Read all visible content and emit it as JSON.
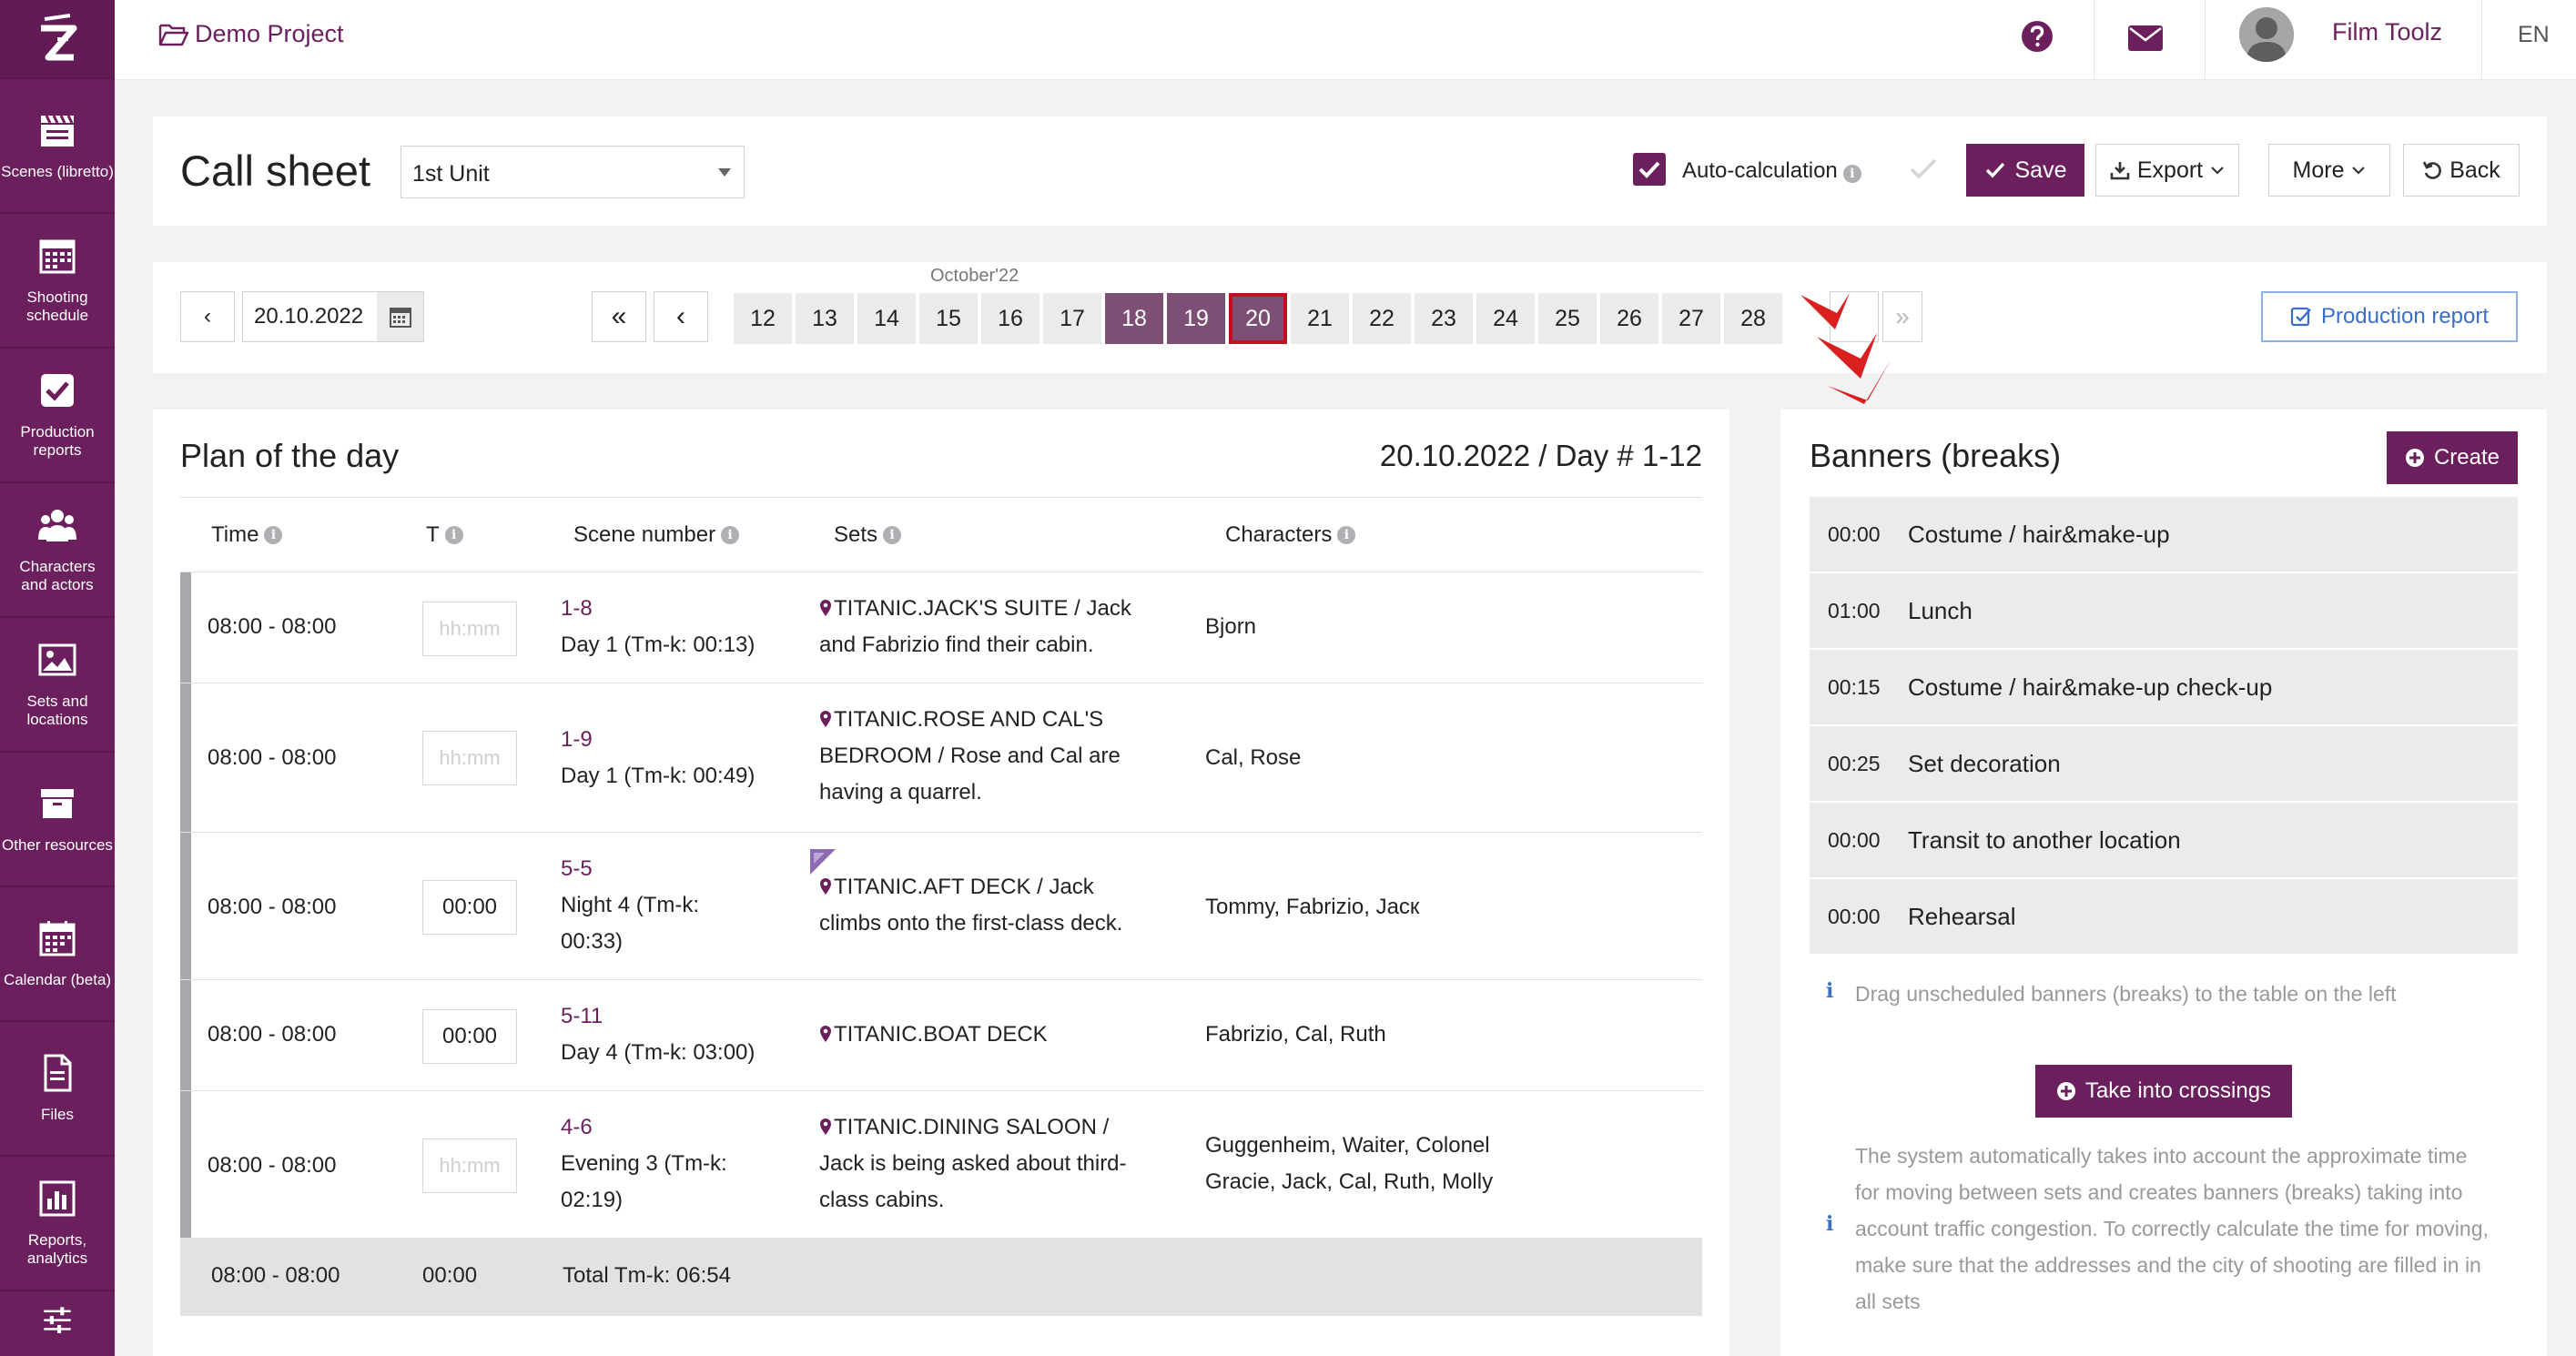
{
  "sidebar": {
    "items": [
      {
        "label": "Scenes (libretto)",
        "icon": "clapperboard-icon"
      },
      {
        "label": "Shooting schedule",
        "icon": "schedule-icon"
      },
      {
        "label": "Production reports",
        "icon": "checkbox-icon"
      },
      {
        "label": "Characters and actors",
        "icon": "people-icon"
      },
      {
        "label": "Sets and locations",
        "icon": "image-icon"
      },
      {
        "label": "Other resources",
        "icon": "box-icon"
      },
      {
        "label": "Calendar (beta)",
        "icon": "calendar-icon"
      },
      {
        "label": "Files",
        "icon": "file-icon"
      },
      {
        "label": "Reports, analytics",
        "icon": "chart-icon"
      }
    ]
  },
  "topbar": {
    "project": "Demo Project",
    "user": "Film Toolz",
    "lang": "EN"
  },
  "header": {
    "title": "Call sheet",
    "unit": "1st Unit",
    "auto_calc": "Auto-calculation",
    "save": "Save",
    "export": "Export",
    "more": "More",
    "back": "Back"
  },
  "datebar": {
    "date": "20.10.2022",
    "month": "October'22",
    "days": [
      "12",
      "13",
      "14",
      "15",
      "16",
      "17",
      "18",
      "19",
      "20",
      "21",
      "22",
      "23",
      "24",
      "25",
      "26",
      "27",
      "28"
    ],
    "first": "«",
    "prev": "‹",
    "last": "»",
    "production_report": "Production report"
  },
  "plan": {
    "title": "Plan of the day",
    "date_day": "20.10.2022 / Day # 1-12",
    "columns": {
      "time": "Time",
      "t": "T",
      "scene": "Scene number",
      "sets": "Sets",
      "characters": "Characters"
    },
    "placeholder": "hh:mm",
    "rows": [
      {
        "time": "08:00 - 08:00",
        "t": "",
        "scene": "1-8",
        "scene_sub": "Day 1 (Tm-k: 00:13)",
        "set_l1": "TITANIC.JACK'S SUITE / Jack",
        "set_l2": "and Fabrizio find their cabin.",
        "set_l3": "",
        "chars_l1": "Bjorn",
        "chars_l2": ""
      },
      {
        "time": "08:00 - 08:00",
        "t": "",
        "scene": "1-9",
        "scene_sub": "Day 1 (Tm-k: 00:49)",
        "set_l1": "TITANIC.ROSE AND CAL'S",
        "set_l2": "BEDROOM / Rose and Cal are",
        "set_l3": "having a quarrel.",
        "chars_l1": "Cal, Rose",
        "chars_l2": ""
      },
      {
        "time": "08:00 - 08:00",
        "t": "00:00",
        "scene": "5-5",
        "scene_sub": "Night 4 (Tm-k:",
        "scene_sub2": "00:33)",
        "set_l1": "TITANIC.AFT DECK / Jack",
        "set_l2": "climbs onto the first-class deck.",
        "set_l3": "",
        "chars_l1": "Tommy, Fabrizio, Jacк",
        "chars_l2": ""
      },
      {
        "time": "08:00 - 08:00",
        "t": "00:00",
        "scene": "5-11",
        "scene_sub": "Day 4 (Tm-k: 03:00)",
        "set_l1": "TITANIC.BOAT DECK",
        "set_l2": "",
        "set_l3": "",
        "chars_l1": "Fabrizio, Cal, Ruth",
        "chars_l2": ""
      },
      {
        "time": "08:00 - 08:00",
        "t": "",
        "scene": "4-6",
        "scene_sub": "Evening 3 (Tm-k:",
        "scene_sub2": "02:19)",
        "set_l1": "TITANIC.DINING SALOON /",
        "set_l2": "Jack is being asked about third-",
        "set_l3": "class cabins.",
        "chars_l1": "Guggenheim, Waiter, Colonel",
        "chars_l2": "Gracie, Jack, Cal, Ruth, Molly"
      }
    ],
    "total": {
      "time": "08:00 - 08:00",
      "t": "00:00",
      "label": "Total Tm-k: 06:54"
    }
  },
  "banners": {
    "title": "Banners (breaks)",
    "create": "Create",
    "items": [
      {
        "time": "00:00",
        "name": "Costume / hair&make-up"
      },
      {
        "time": "01:00",
        "name": "Lunch"
      },
      {
        "time": "00:15",
        "name": "Costume / hair&make-up check-up"
      },
      {
        "time": "00:25",
        "name": "Set decoration"
      },
      {
        "time": "00:00",
        "name": "Transit to another location"
      },
      {
        "time": "00:00",
        "name": "Rehearsal"
      }
    ],
    "hint": "Drag unscheduled banners (breaks) to the table on the left",
    "take_btn": "Take into crossings",
    "info_lines": [
      "The system automatically takes into account the approximate time",
      "for moving between sets and creates banners (breaks) taking into",
      "account traffic congestion. To correctly calculate the time for moving,",
      "make sure that the addresses and the city of shooting are filled in in",
      "all sets"
    ]
  },
  "colors": {
    "brand": "#6b1f5c",
    "active_day": "#7e4f74",
    "current_border": "#c0101f",
    "info": "#3a6fc9"
  }
}
